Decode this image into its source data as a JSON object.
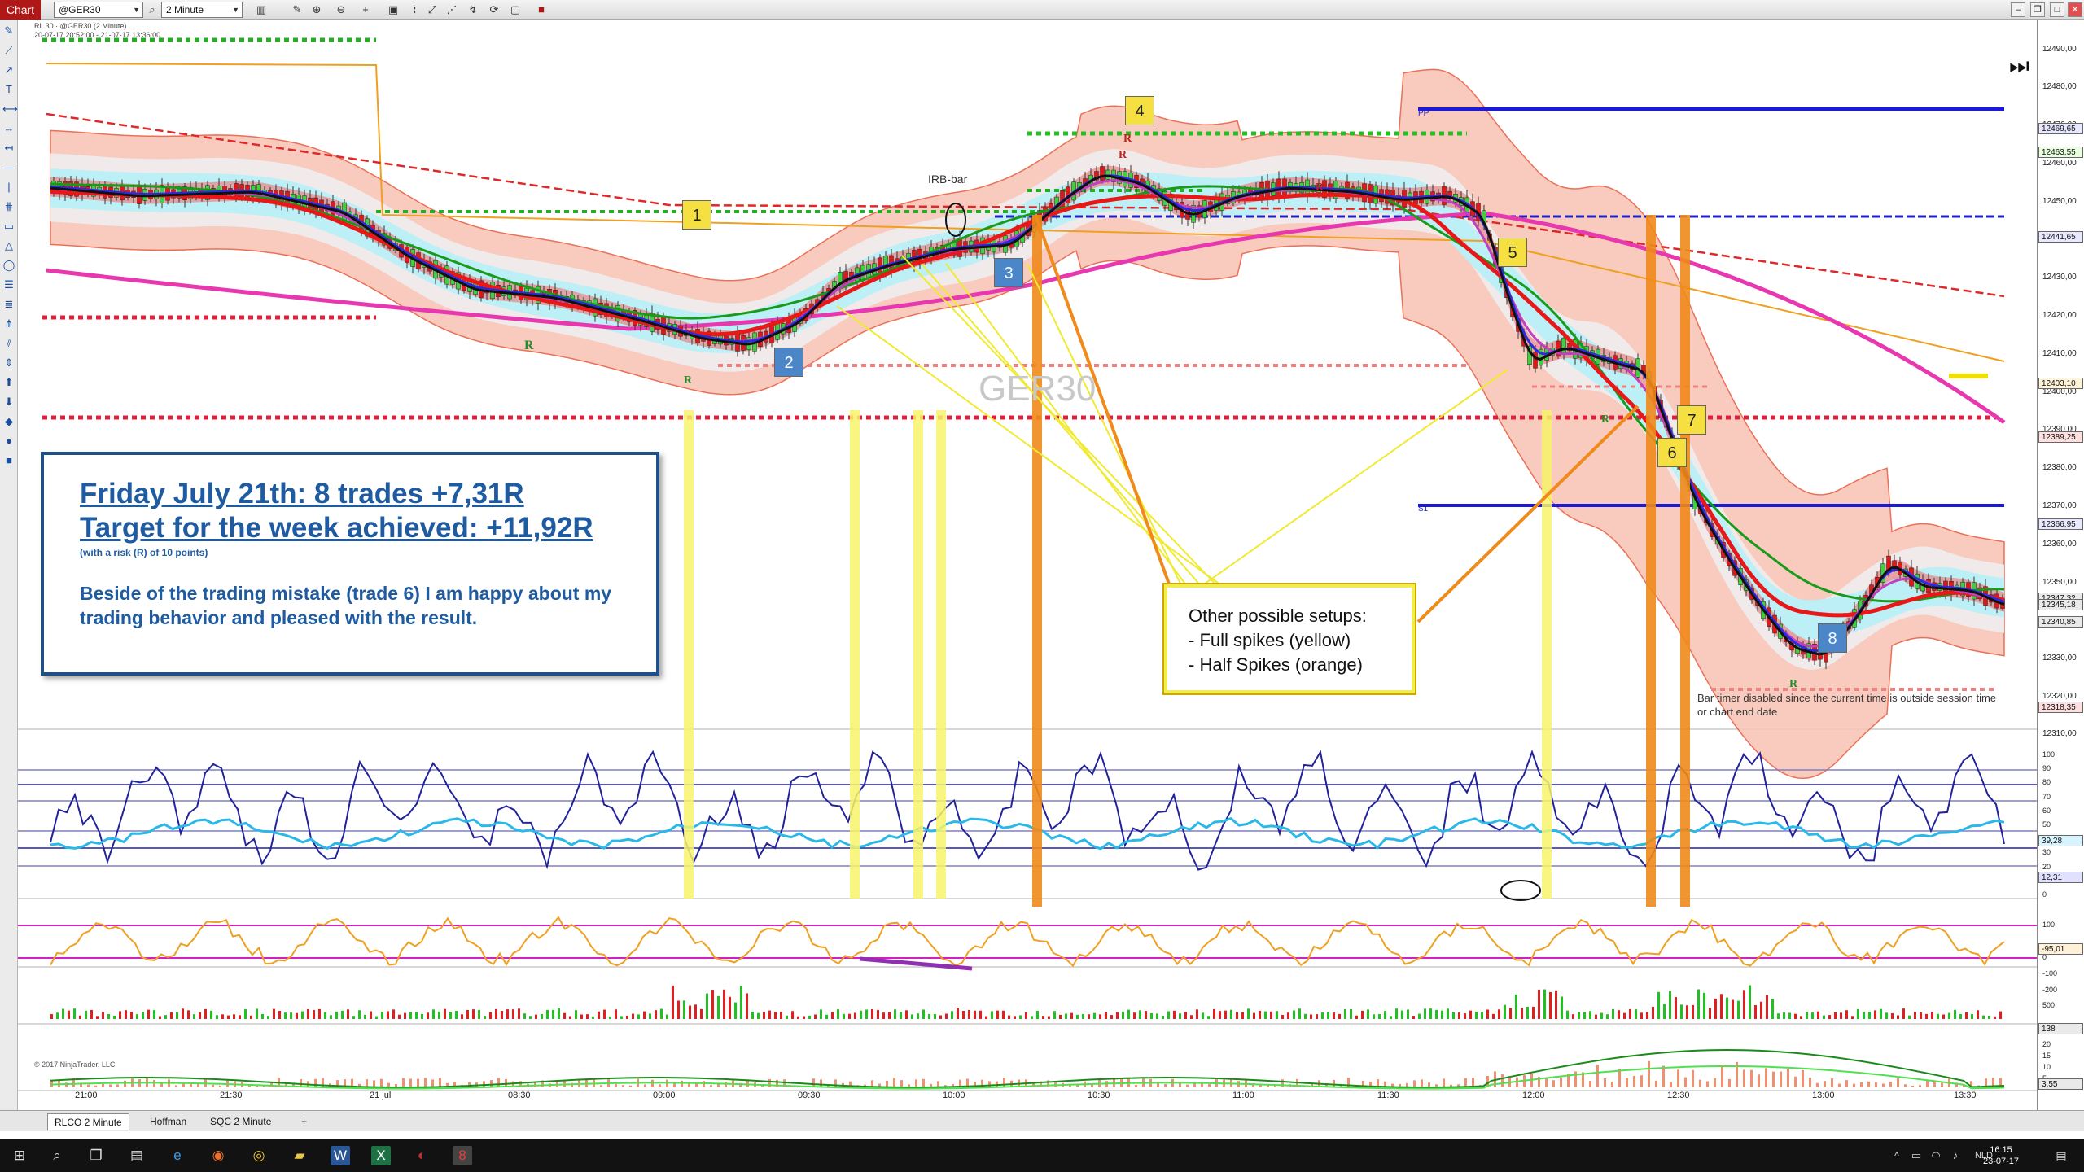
{
  "toolbar": {
    "chart_label": "Chart",
    "instrument": "@GER30",
    "timeframe": "2 Minute"
  },
  "chart": {
    "header_line1": "RL 30 · @GER30 (2 Minute)",
    "header_line2": "20-07-17 20:52:00 - 21-07-17 13:36:00",
    "watermark": "GER30",
    "irb_label": "IRB-bar",
    "copyright": "© 2017 NinjaTrader, LLC",
    "bar_timer_note_1": "Bar timer disabled since the current time is outside session time",
    "bar_timer_note_2": "or chart end date",
    "trade_labels": [
      "1",
      "2",
      "3",
      "4",
      "5",
      "6",
      "7",
      "8"
    ],
    "r_marks": [
      "R",
      "R",
      "R",
      "R",
      "R",
      "R",
      "R"
    ],
    "level_marks": [
      "PP",
      "S1"
    ]
  },
  "info_box": {
    "line1": "Friday July 21th: 8 trades +7,31R",
    "line2": "Target for the week achieved: +11,92R",
    "line3": "(with a risk (R) of 10 points)",
    "line4": "Beside of the trading mistake (trade 6) I am happy about my trading behavior and pleased with the result."
  },
  "setups_box": {
    "title": "Other possible setups:",
    "item1": "- Full spikes (yellow)",
    "item2": "- Half Spikes (orange)"
  },
  "price_axis": {
    "ticks": [
      "12490,00",
      "12480,00",
      "12470,00",
      "12460,00",
      "12450,00",
      "12440,00",
      "12430,00",
      "12420,00",
      "12410,00",
      "12400,00",
      "12390,00",
      "12380,00",
      "12370,00",
      "12360,00",
      "12350,00",
      "12340,00",
      "12330,00",
      "12320,00",
      "12310,00"
    ],
    "boxes": [
      "12469,65",
      "12463,55",
      "12441,65",
      "12403,10",
      "12389,25",
      "12366,95",
      "12347,32",
      "12345,18",
      "12340,85",
      "12318,35"
    ],
    "osc1_ticks": [
      "100",
      "90",
      "80",
      "70",
      "60",
      "50",
      "40",
      "30",
      "20",
      "10",
      "0"
    ],
    "osc1_boxes": [
      "39,28",
      "12,31"
    ],
    "osc2_ticks": [
      "100",
      "0",
      "-100",
      "-200"
    ],
    "osc2_box": "-95,01",
    "vol_ticks": [
      "500"
    ],
    "vol_box": "138",
    "vol2_ticks": [
      "20",
      "15",
      "10",
      "5"
    ],
    "vol2_box": "3,55"
  },
  "time_axis": [
    "21:00",
    "21:30",
    "21 jul",
    "08:30",
    "09:00",
    "09:30",
    "10:00",
    "10:30",
    "11:00",
    "11:30",
    "12:00",
    "12:30",
    "13:00",
    "13:30"
  ],
  "tabs": [
    "RLCO  2 Minute",
    "Hoffman",
    "SQC  2 Minute",
    "+"
  ],
  "taskbar": {
    "lang": "NLD",
    "time": "16:15",
    "date": "23-07-17"
  },
  "colors": {
    "accent_blue": "#1f5ba0",
    "chart_red": "#e02020",
    "setup_yellow": "#f6f35a",
    "setup_orange": "#f08a1a"
  }
}
